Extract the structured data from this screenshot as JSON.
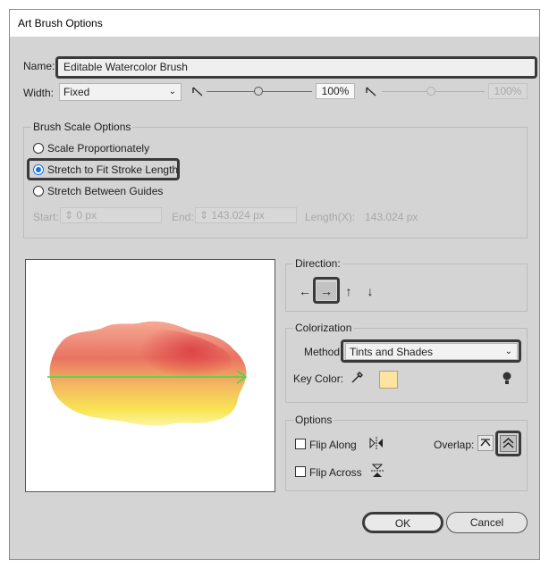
{
  "dialog": {
    "title": "Art Brush Options"
  },
  "name": {
    "label": "Name:",
    "value": "Editable Watercolor Brush"
  },
  "width": {
    "label": "Width:",
    "select_value": "Fixed",
    "value": "100%",
    "value_disabled": "100%"
  },
  "brush_scale": {
    "title": "Brush Scale Options",
    "options": [
      "Scale Proportionately",
      "Stretch to Fit Stroke Length",
      "Stretch Between Guides"
    ],
    "selected_index": 1,
    "start_label": "Start:",
    "start_value": "0 px",
    "end_label": "End:",
    "end_value": "143.024 px",
    "length_label": "Length(X):",
    "length_value": "143.024 px"
  },
  "direction": {
    "title": "Direction:",
    "buttons": [
      "←",
      "→",
      "↑",
      "↓"
    ],
    "selected_index": 1
  },
  "colorization": {
    "title": "Colorization",
    "method_label": "Method:",
    "method_value": "Tints and Shades",
    "key_color_label": "Key Color:",
    "key_color": "#fde4a0"
  },
  "options": {
    "title": "Options",
    "flip_along": "Flip Along",
    "flip_across": "Flip Across",
    "overlap_label": "Overlap:"
  },
  "buttons": {
    "ok": "OK",
    "cancel": "Cancel"
  },
  "icons": [
    "dropdown-chevron-icon",
    "slider-min-icon",
    "slider-max-icon",
    "spinner-icon",
    "eyedropper-icon",
    "tip-bulb-icon",
    "flip-along-icon",
    "flip-across-icon",
    "overlap-adjust-icon",
    "overlap-no-adjust-icon"
  ]
}
